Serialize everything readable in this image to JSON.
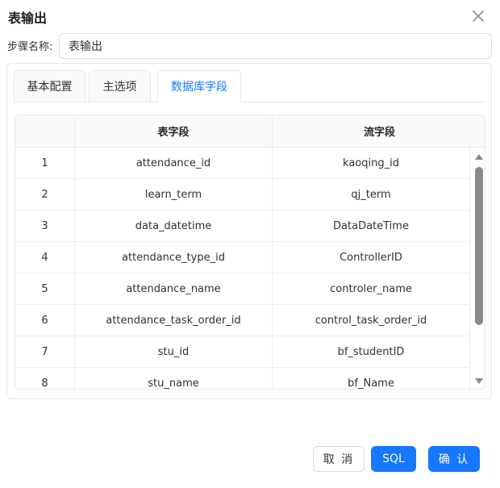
{
  "dialog": {
    "title": "表输出",
    "step_name_label": "步骤名称:",
    "step_name_value": "表输出"
  },
  "tabs": [
    {
      "label": "基本配置",
      "active": false
    },
    {
      "label": "主选项",
      "active": false
    },
    {
      "label": "数据库字段",
      "active": true
    }
  ],
  "table": {
    "headers": [
      "",
      "表字段",
      "流字段"
    ],
    "rows": [
      {
        "index": "1",
        "table_field": "attendance_id",
        "stream_field": "kaoqing_id"
      },
      {
        "index": "2",
        "table_field": "learn_term",
        "stream_field": "qj_term"
      },
      {
        "index": "3",
        "table_field": "data_datetime",
        "stream_field": "DataDateTime"
      },
      {
        "index": "4",
        "table_field": "attendance_type_id",
        "stream_field": "ControllerID"
      },
      {
        "index": "5",
        "table_field": "attendance_name",
        "stream_field": "controler_name"
      },
      {
        "index": "6",
        "table_field": "attendance_task_order_id",
        "stream_field": "control_task_order_id"
      },
      {
        "index": "7",
        "table_field": "stu_id",
        "stream_field": "bf_studentID"
      },
      {
        "index": "8",
        "table_field": "stu_name",
        "stream_field": "bf_Name"
      }
    ]
  },
  "buttons": {
    "cancel": "取 消",
    "sql": "SQL",
    "confirm": "确 认"
  },
  "colors": {
    "primary": "#1677ff",
    "border": "#e4e7ed"
  },
  "icons": {
    "close": "close-icon",
    "scroll_up": "arrow-up-icon",
    "scroll_down": "arrow-down-icon"
  }
}
